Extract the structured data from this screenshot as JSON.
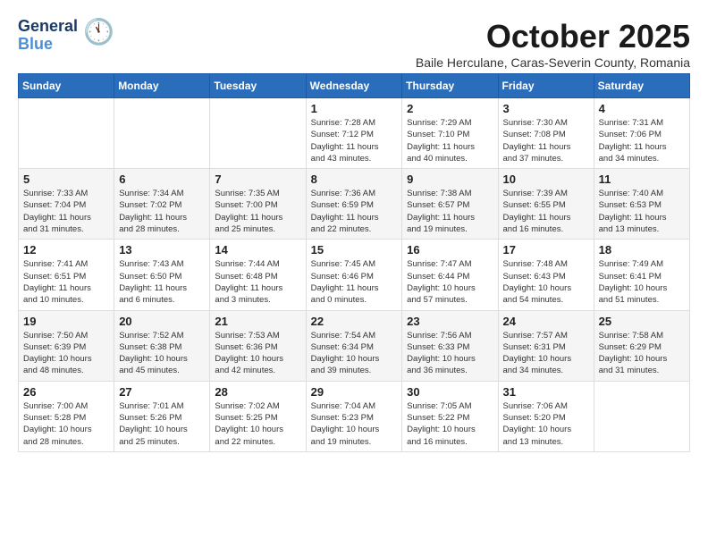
{
  "header": {
    "logo_line1": "General",
    "logo_line2": "Blue",
    "month": "October 2025",
    "location": "Baile Herculane, Caras-Severin County, Romania"
  },
  "days_of_week": [
    "Sunday",
    "Monday",
    "Tuesday",
    "Wednesday",
    "Thursday",
    "Friday",
    "Saturday"
  ],
  "weeks": [
    [
      {
        "day": "",
        "info": ""
      },
      {
        "day": "",
        "info": ""
      },
      {
        "day": "",
        "info": ""
      },
      {
        "day": "1",
        "info": "Sunrise: 7:28 AM\nSunset: 7:12 PM\nDaylight: 11 hours\nand 43 minutes."
      },
      {
        "day": "2",
        "info": "Sunrise: 7:29 AM\nSunset: 7:10 PM\nDaylight: 11 hours\nand 40 minutes."
      },
      {
        "day": "3",
        "info": "Sunrise: 7:30 AM\nSunset: 7:08 PM\nDaylight: 11 hours\nand 37 minutes."
      },
      {
        "day": "4",
        "info": "Sunrise: 7:31 AM\nSunset: 7:06 PM\nDaylight: 11 hours\nand 34 minutes."
      }
    ],
    [
      {
        "day": "5",
        "info": "Sunrise: 7:33 AM\nSunset: 7:04 PM\nDaylight: 11 hours\nand 31 minutes."
      },
      {
        "day": "6",
        "info": "Sunrise: 7:34 AM\nSunset: 7:02 PM\nDaylight: 11 hours\nand 28 minutes."
      },
      {
        "day": "7",
        "info": "Sunrise: 7:35 AM\nSunset: 7:00 PM\nDaylight: 11 hours\nand 25 minutes."
      },
      {
        "day": "8",
        "info": "Sunrise: 7:36 AM\nSunset: 6:59 PM\nDaylight: 11 hours\nand 22 minutes."
      },
      {
        "day": "9",
        "info": "Sunrise: 7:38 AM\nSunset: 6:57 PM\nDaylight: 11 hours\nand 19 minutes."
      },
      {
        "day": "10",
        "info": "Sunrise: 7:39 AM\nSunset: 6:55 PM\nDaylight: 11 hours\nand 16 minutes."
      },
      {
        "day": "11",
        "info": "Sunrise: 7:40 AM\nSunset: 6:53 PM\nDaylight: 11 hours\nand 13 minutes."
      }
    ],
    [
      {
        "day": "12",
        "info": "Sunrise: 7:41 AM\nSunset: 6:51 PM\nDaylight: 11 hours\nand 10 minutes."
      },
      {
        "day": "13",
        "info": "Sunrise: 7:43 AM\nSunset: 6:50 PM\nDaylight: 11 hours\nand 6 minutes."
      },
      {
        "day": "14",
        "info": "Sunrise: 7:44 AM\nSunset: 6:48 PM\nDaylight: 11 hours\nand 3 minutes."
      },
      {
        "day": "15",
        "info": "Sunrise: 7:45 AM\nSunset: 6:46 PM\nDaylight: 11 hours\nand 0 minutes."
      },
      {
        "day": "16",
        "info": "Sunrise: 7:47 AM\nSunset: 6:44 PM\nDaylight: 10 hours\nand 57 minutes."
      },
      {
        "day": "17",
        "info": "Sunrise: 7:48 AM\nSunset: 6:43 PM\nDaylight: 10 hours\nand 54 minutes."
      },
      {
        "day": "18",
        "info": "Sunrise: 7:49 AM\nSunset: 6:41 PM\nDaylight: 10 hours\nand 51 minutes."
      }
    ],
    [
      {
        "day": "19",
        "info": "Sunrise: 7:50 AM\nSunset: 6:39 PM\nDaylight: 10 hours\nand 48 minutes."
      },
      {
        "day": "20",
        "info": "Sunrise: 7:52 AM\nSunset: 6:38 PM\nDaylight: 10 hours\nand 45 minutes."
      },
      {
        "day": "21",
        "info": "Sunrise: 7:53 AM\nSunset: 6:36 PM\nDaylight: 10 hours\nand 42 minutes."
      },
      {
        "day": "22",
        "info": "Sunrise: 7:54 AM\nSunset: 6:34 PM\nDaylight: 10 hours\nand 39 minutes."
      },
      {
        "day": "23",
        "info": "Sunrise: 7:56 AM\nSunset: 6:33 PM\nDaylight: 10 hours\nand 36 minutes."
      },
      {
        "day": "24",
        "info": "Sunrise: 7:57 AM\nSunset: 6:31 PM\nDaylight: 10 hours\nand 34 minutes."
      },
      {
        "day": "25",
        "info": "Sunrise: 7:58 AM\nSunset: 6:29 PM\nDaylight: 10 hours\nand 31 minutes."
      }
    ],
    [
      {
        "day": "26",
        "info": "Sunrise: 7:00 AM\nSunset: 5:28 PM\nDaylight: 10 hours\nand 28 minutes."
      },
      {
        "day": "27",
        "info": "Sunrise: 7:01 AM\nSunset: 5:26 PM\nDaylight: 10 hours\nand 25 minutes."
      },
      {
        "day": "28",
        "info": "Sunrise: 7:02 AM\nSunset: 5:25 PM\nDaylight: 10 hours\nand 22 minutes."
      },
      {
        "day": "29",
        "info": "Sunrise: 7:04 AM\nSunset: 5:23 PM\nDaylight: 10 hours\nand 19 minutes."
      },
      {
        "day": "30",
        "info": "Sunrise: 7:05 AM\nSunset: 5:22 PM\nDaylight: 10 hours\nand 16 minutes."
      },
      {
        "day": "31",
        "info": "Sunrise: 7:06 AM\nSunset: 5:20 PM\nDaylight: 10 hours\nand 13 minutes."
      },
      {
        "day": "",
        "info": ""
      }
    ]
  ]
}
